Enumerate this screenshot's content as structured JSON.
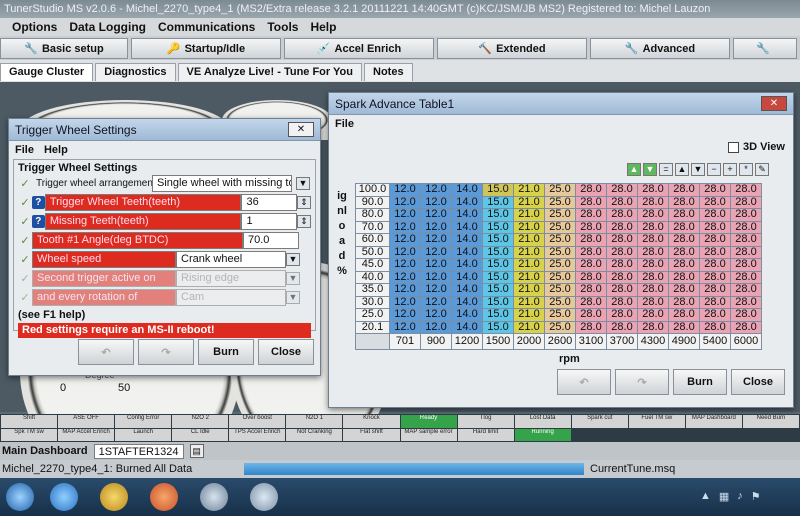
{
  "app": {
    "title": "TunerStudio MS v2.0.6 - Michel_2270_type4_1 (MS2/Extra release 3.2.1 20111221 14:40GMT (c)KC/JSM/JB MS2) Registered to: Michel Lauzon"
  },
  "menu": [
    "Options",
    "Data Logging",
    "Communications",
    "Tools",
    "Help"
  ],
  "toolbar": [
    {
      "label": "Basic setup",
      "icon": "wrench-icon"
    },
    {
      "label": "Startup/Idle",
      "icon": "key-icon"
    },
    {
      "label": "Accel Enrich",
      "icon": "syringe-icon"
    },
    {
      "label": "Extended",
      "icon": "hammer-icon"
    },
    {
      "label": "Advanced",
      "icon": "wrench-icon"
    },
    {
      "label": "",
      "icon": "wrench-icon"
    }
  ],
  "tabs": [
    "Gauge Cluster",
    "Diagnostics",
    "VE Analyze Live! - Tune For You",
    "Notes"
  ],
  "gauges": {
    "left_ticks": [
      "0",
      "50"
    ],
    "left_label": "Degree"
  },
  "trigger_window": {
    "title": "Trigger Wheel Settings",
    "menu": [
      "File",
      "Help"
    ],
    "group_title": "Trigger Wheel Settings",
    "arrangement_label": "Trigger wheel arrangement",
    "arrangement_value": "Single wheel with missing tooth",
    "fields": [
      {
        "label": "Trigger Wheel Teeth(teeth)",
        "value": "36"
      },
      {
        "label": "Missing Teeth(teeth)",
        "value": "1"
      },
      {
        "label": "Tooth #1 Angle(deg BTDC)",
        "value": "70.0"
      }
    ],
    "wheel_speed_label": "Wheel speed",
    "wheel_speed_value": "Crank wheel",
    "second_trigger_label": "Second trigger active on",
    "second_trigger_value": "Rising edge",
    "rotation_label": "and every rotation of",
    "rotation_value": "Cam",
    "help_text": "(see F1 help)",
    "warning": "Red settings require an MS-II reboot!",
    "burn": "Burn",
    "close": "Close"
  },
  "spark_window": {
    "title": "Spark Advance Table1",
    "menu": [
      "File"
    ],
    "view_3d": "3D View",
    "y_axis_label": "ignload %",
    "x_axis_label": "rpm",
    "load_bins": [
      "100.0",
      "90.0",
      "80.0",
      "70.0",
      "60.0",
      "50.0",
      "45.0",
      "40.0",
      "35.0",
      "30.0",
      "25.0",
      "20.1"
    ],
    "rpm_bins": [
      "701",
      "900",
      "1200",
      "1500",
      "2000",
      "2600",
      "3100",
      "3700",
      "4300",
      "4900",
      "5400",
      "6000"
    ],
    "row_values": [
      "12.0",
      "12.0",
      "14.0",
      "15.0",
      "21.0",
      "25.0",
      "28.0",
      "28.0",
      "28.0",
      "28.0",
      "28.0",
      "28.0"
    ],
    "burn": "Burn",
    "close": "Close"
  },
  "status_indicators": [
    "Shift",
    "ASE OFF",
    "Config Error",
    "N2O 2",
    "Over boost",
    "N2O 1",
    "Knock",
    "Ready",
    "Tlog",
    "Lost Data",
    "Spark cut",
    "Fuel TM sw",
    "MAP Dashboard",
    "Need Burn",
    "Spk TM sw",
    "MAP Accel Enrich",
    "Launch",
    "CL Idle",
    "TPS Accel Enrich",
    "Not Cranking",
    "Flat shift",
    "MAP sample error",
    "Hard limit",
    "Running"
  ],
  "status_on": [
    "Ready",
    "Running"
  ],
  "dashboard": {
    "label": "Main Dashboard",
    "field": "1STAFTER1324"
  },
  "burnbar": {
    "message": "Michel_2270_type4_1: Burned All Data",
    "tune": "CurrentTune.msq"
  },
  "colors": {
    "blue": "#5b9ad9",
    "cyan": "#5dc6e6",
    "yellow": "#d8d24a",
    "olive": "#cfc45a",
    "tan": "#e6c89a",
    "pink": "#e9a3b2",
    "red": "#dd2b20"
  }
}
